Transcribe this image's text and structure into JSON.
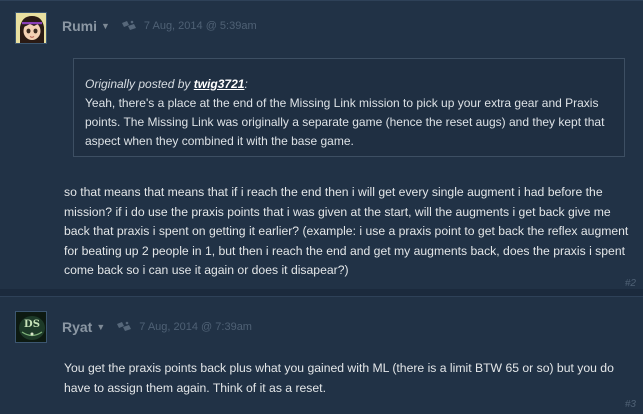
{
  "posts": [
    {
      "author": "Rumi",
      "timestamp": "7 Aug, 2014 @ 5:39am",
      "avatar_icon": "anime-girl-avatar",
      "quote": {
        "prefix": "Originally posted by ",
        "author": "twig3721",
        "suffix": ":",
        "text": "Yeah, there's a place at the end of the Missing Link mission to pick up your extra gear and Praxis points. The Missing Link was originally a separate game (hence the reset augs) and they kept that aspect when they combined it with the base game."
      },
      "body": "so that means that means that if i reach the end then i will get every single augment i had before the mission? if i do use the praxis points that i was given at the start, will the augments i get back give me back that praxis i spent on getting it earlier? (example: i use a praxis point to get back the reflex augment for beating up 2 people in 1, but then i reach the end and get my augments back, does the praxis i spent come back so i can use it again or does it disapear?)",
      "number": "#2"
    },
    {
      "author": "Ryat",
      "timestamp": "7 Aug, 2014 @ 7:39am",
      "avatar_icon": "ds-logo-avatar",
      "body": "You get the praxis points back plus what you gained with ML (there is a limit BTW 65 or so) but you do have to assign them again. Think of it as a reset.",
      "number": "#3"
    }
  ],
  "colors": {
    "background": "#1b2a3d",
    "post_background": "#213246",
    "author": "#8b97a3",
    "timestamp": "#4f6175",
    "text": "#e3e6e8"
  }
}
